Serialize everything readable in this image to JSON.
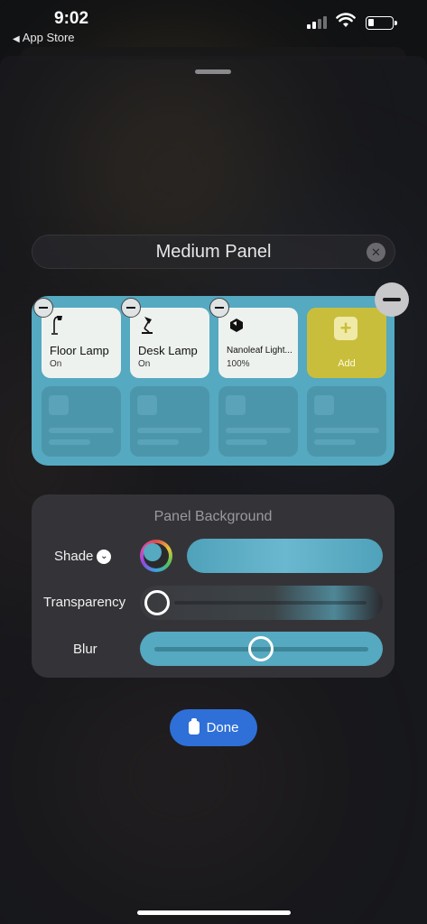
{
  "status_bar": {
    "time": "9:02",
    "back_app": "App Store",
    "back_glyph": "◀"
  },
  "editor": {
    "panel_name": "Medium Panel",
    "clear_glyph": "✕"
  },
  "panel": {
    "color": "#55a9c1",
    "tiles": [
      {
        "name": "Floor Lamp",
        "state": "On",
        "icon": "floor-lamp-icon"
      },
      {
        "name": "Desk Lamp",
        "state": "On",
        "icon": "desk-lamp-icon"
      },
      {
        "name": "Nanoleaf Light...",
        "state": "100%",
        "icon": "nanoleaf-icon"
      }
    ],
    "add_tile": {
      "label": "Add",
      "glyph": "+"
    }
  },
  "background_settings": {
    "title": "Panel Background",
    "shade_label": "Shade",
    "shade_chevron": "⌄",
    "transparency_label": "Transparency",
    "transparency_value": 0.0,
    "blur_label": "Blur",
    "blur_value": 0.5
  },
  "done_button": {
    "label": "Done"
  }
}
